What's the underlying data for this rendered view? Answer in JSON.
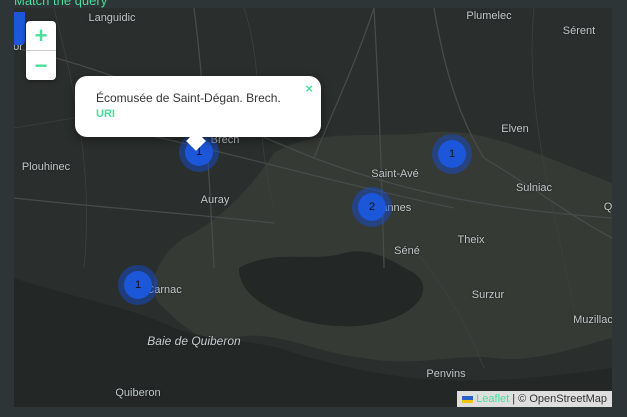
{
  "heading": "Match the query",
  "map": {
    "places": [
      {
        "name": "Languidic",
        "key": "languidic"
      },
      {
        "name": "Plumelec",
        "key": "plumelec"
      },
      {
        "name": "Sérent",
        "key": "serent"
      },
      {
        "name": "Elven",
        "key": "elven"
      },
      {
        "name": "Plouhinec",
        "key": "plouhinec"
      },
      {
        "name": "Saint-Avé",
        "key": "saint-ave"
      },
      {
        "name": "Sulniac",
        "key": "sulniac"
      },
      {
        "name": "Auray",
        "key": "auray"
      },
      {
        "name": "Vannes",
        "key": "vannes"
      },
      {
        "name": "Séné",
        "key": "sene"
      },
      {
        "name": "Theix",
        "key": "theix"
      },
      {
        "name": "Carnac",
        "key": "carnac"
      },
      {
        "name": "Surzur",
        "key": "surzur"
      },
      {
        "name": "Muzillac",
        "key": "muzillac"
      },
      {
        "name": "Baie de Quiberon",
        "key": "baie-de-quiberon"
      },
      {
        "name": "Penvins",
        "key": "penvins"
      },
      {
        "name": "Quiberon",
        "key": "quiberon"
      },
      {
        "name": "Brech",
        "key": "brech"
      },
      {
        "name": "Q",
        "key": "q-edge"
      },
      {
        "name": "or",
        "key": "or-edge"
      }
    ],
    "clusters": [
      {
        "count": "1",
        "key": "brech"
      },
      {
        "count": "1",
        "key": "elven"
      },
      {
        "count": "2",
        "key": "vannes"
      },
      {
        "count": "1",
        "key": "carnac"
      }
    ]
  },
  "zoom": {
    "in_label": "+",
    "out_label": "−"
  },
  "popup": {
    "text": "Écomusée de Saint-Dégan. Brech.",
    "link": "URI",
    "close": "×"
  },
  "attribution": {
    "leaflet": "Leaflet",
    "separator": " | ",
    "osm": "© OpenStreetMap"
  },
  "colors": {
    "accent": "#4ade9b",
    "cluster": "#1b57d8",
    "land": "#353a35",
    "water": "#262a2b"
  }
}
